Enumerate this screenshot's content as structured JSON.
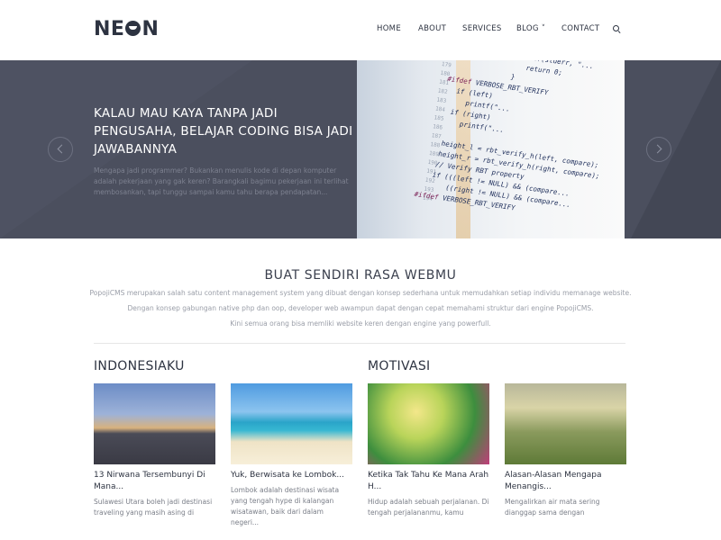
{
  "header": {
    "logo": "NEON",
    "nav": [
      {
        "label": "HOME"
      },
      {
        "label": "ABOUT"
      },
      {
        "label": "SERVICES"
      },
      {
        "label": "BLOG ˅"
      },
      {
        "label": "CONTACT"
      }
    ]
  },
  "hero": {
    "title": "KALAU MAU KAYA TANPA JADI PENGUSAHA, BELAJAR CODING BISA JADI JAWABANNYA",
    "text": "Mengapa jadi programmer? Bukankan menulis kode di depan komputer adalah pekerjaan yang gak keren? Barangkali bagimu pekerjaan ini terlihat membosankan, tapi tunggu sampai kamu tahu berapa pendapatan..."
  },
  "intro": {
    "title": "BUAT SENDIRI RASA WEBMU",
    "paragraphs": [
      "PopojiCMS merupakan salah satu content management system yang dibuat dengan konsep sederhana untuk memudahkan setiap individu memanage website.",
      "Dengan konsep gabungan native php dan oop, developer web awampun dapat dengan cepat memahami struktur dari engine PopojiCMS.",
      "Kini semua orang bisa memliki website keren dengan engine yang powerfull."
    ]
  },
  "sections": [
    {
      "title": "INDONESIAKU"
    },
    {
      "title": "MOTIVASI"
    }
  ],
  "cards": [
    {
      "title": "13 Nirwana Tersembunyi Di Mana...",
      "desc": "Sulawesi Utara boleh jadi destinasi traveling yang masih asing di"
    },
    {
      "title": "Yuk, Berwisata ke Lombok...",
      "desc": "Lombok adalah destinasi wisata yang tengah hype di kalangan wisatawan, baik dari dalam negeri..."
    },
    {
      "title": "Ketika Tak Tahu Ke Mana Arah H...",
      "desc": "Hidup adalah sebuah perjalanan. Di tengah perjalananmu, kamu"
    },
    {
      "title": "Alasan-Alasan Mengapa Menangis...",
      "desc": "Mengalirkan air mata sering dianggap sama dengan"
    }
  ],
  "colors": {
    "hero_bg": "#4b4f5e",
    "text_dark": "#2d3341"
  }
}
